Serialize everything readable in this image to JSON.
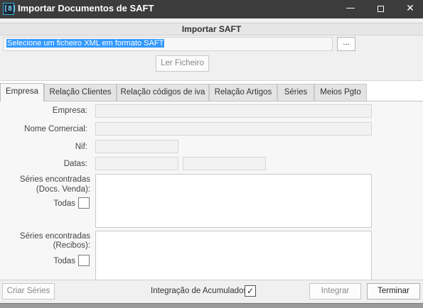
{
  "window": {
    "title": "Importar Documentos de SAFT",
    "icon_text": "[8]",
    "minimize_glyph": "—",
    "close_glyph": "✕"
  },
  "import_panel": {
    "header": "Importar SAFT",
    "file_field_value": "Selecione um ficheiro XML em formato SAFT",
    "browse_label": "...",
    "read_button": "Ler Ficheiro"
  },
  "tabs": [
    {
      "label": "Empresa",
      "active": true
    },
    {
      "label": "Relação Clientes",
      "active": false
    },
    {
      "label": "Relação códigos de iva",
      "active": false
    },
    {
      "label": "Relação Artigos",
      "active": false
    },
    {
      "label": "Séries",
      "active": false
    },
    {
      "label": "Meios Pgto",
      "active": false
    }
  ],
  "form": {
    "empresa_label": "Empresa:",
    "empresa_value": "",
    "nome_comercial_label": "Nome Comercial:",
    "nome_comercial_value": "",
    "nif_label": "Nif:",
    "nif_value": "",
    "datas_label": "Datas:",
    "data_inicio_value": "",
    "data_fim_value": "",
    "series_vendas_label_1": "Séries encontradas",
    "series_vendas_label_2": "(Docs. Venda):",
    "todas_label_1": "Todas",
    "series_recibos_label_1": "Séries encontradas",
    "series_recibos_label_2": "(Recibos):",
    "todas_label_2": "Todas",
    "todas_vendas_checked": false,
    "todas_recibos_checked": false
  },
  "bottom_bar": {
    "criar_series": "Criar Séries",
    "integracao_label": "Integração de Acumulados",
    "integracao_checked": true,
    "check_glyph": "✓",
    "integrar": "Integrar",
    "terminar": "Terminar"
  },
  "colors": {
    "titlebar": "#3c3c3c",
    "selection": "#3399ff",
    "panel": "#f0f0f0"
  }
}
